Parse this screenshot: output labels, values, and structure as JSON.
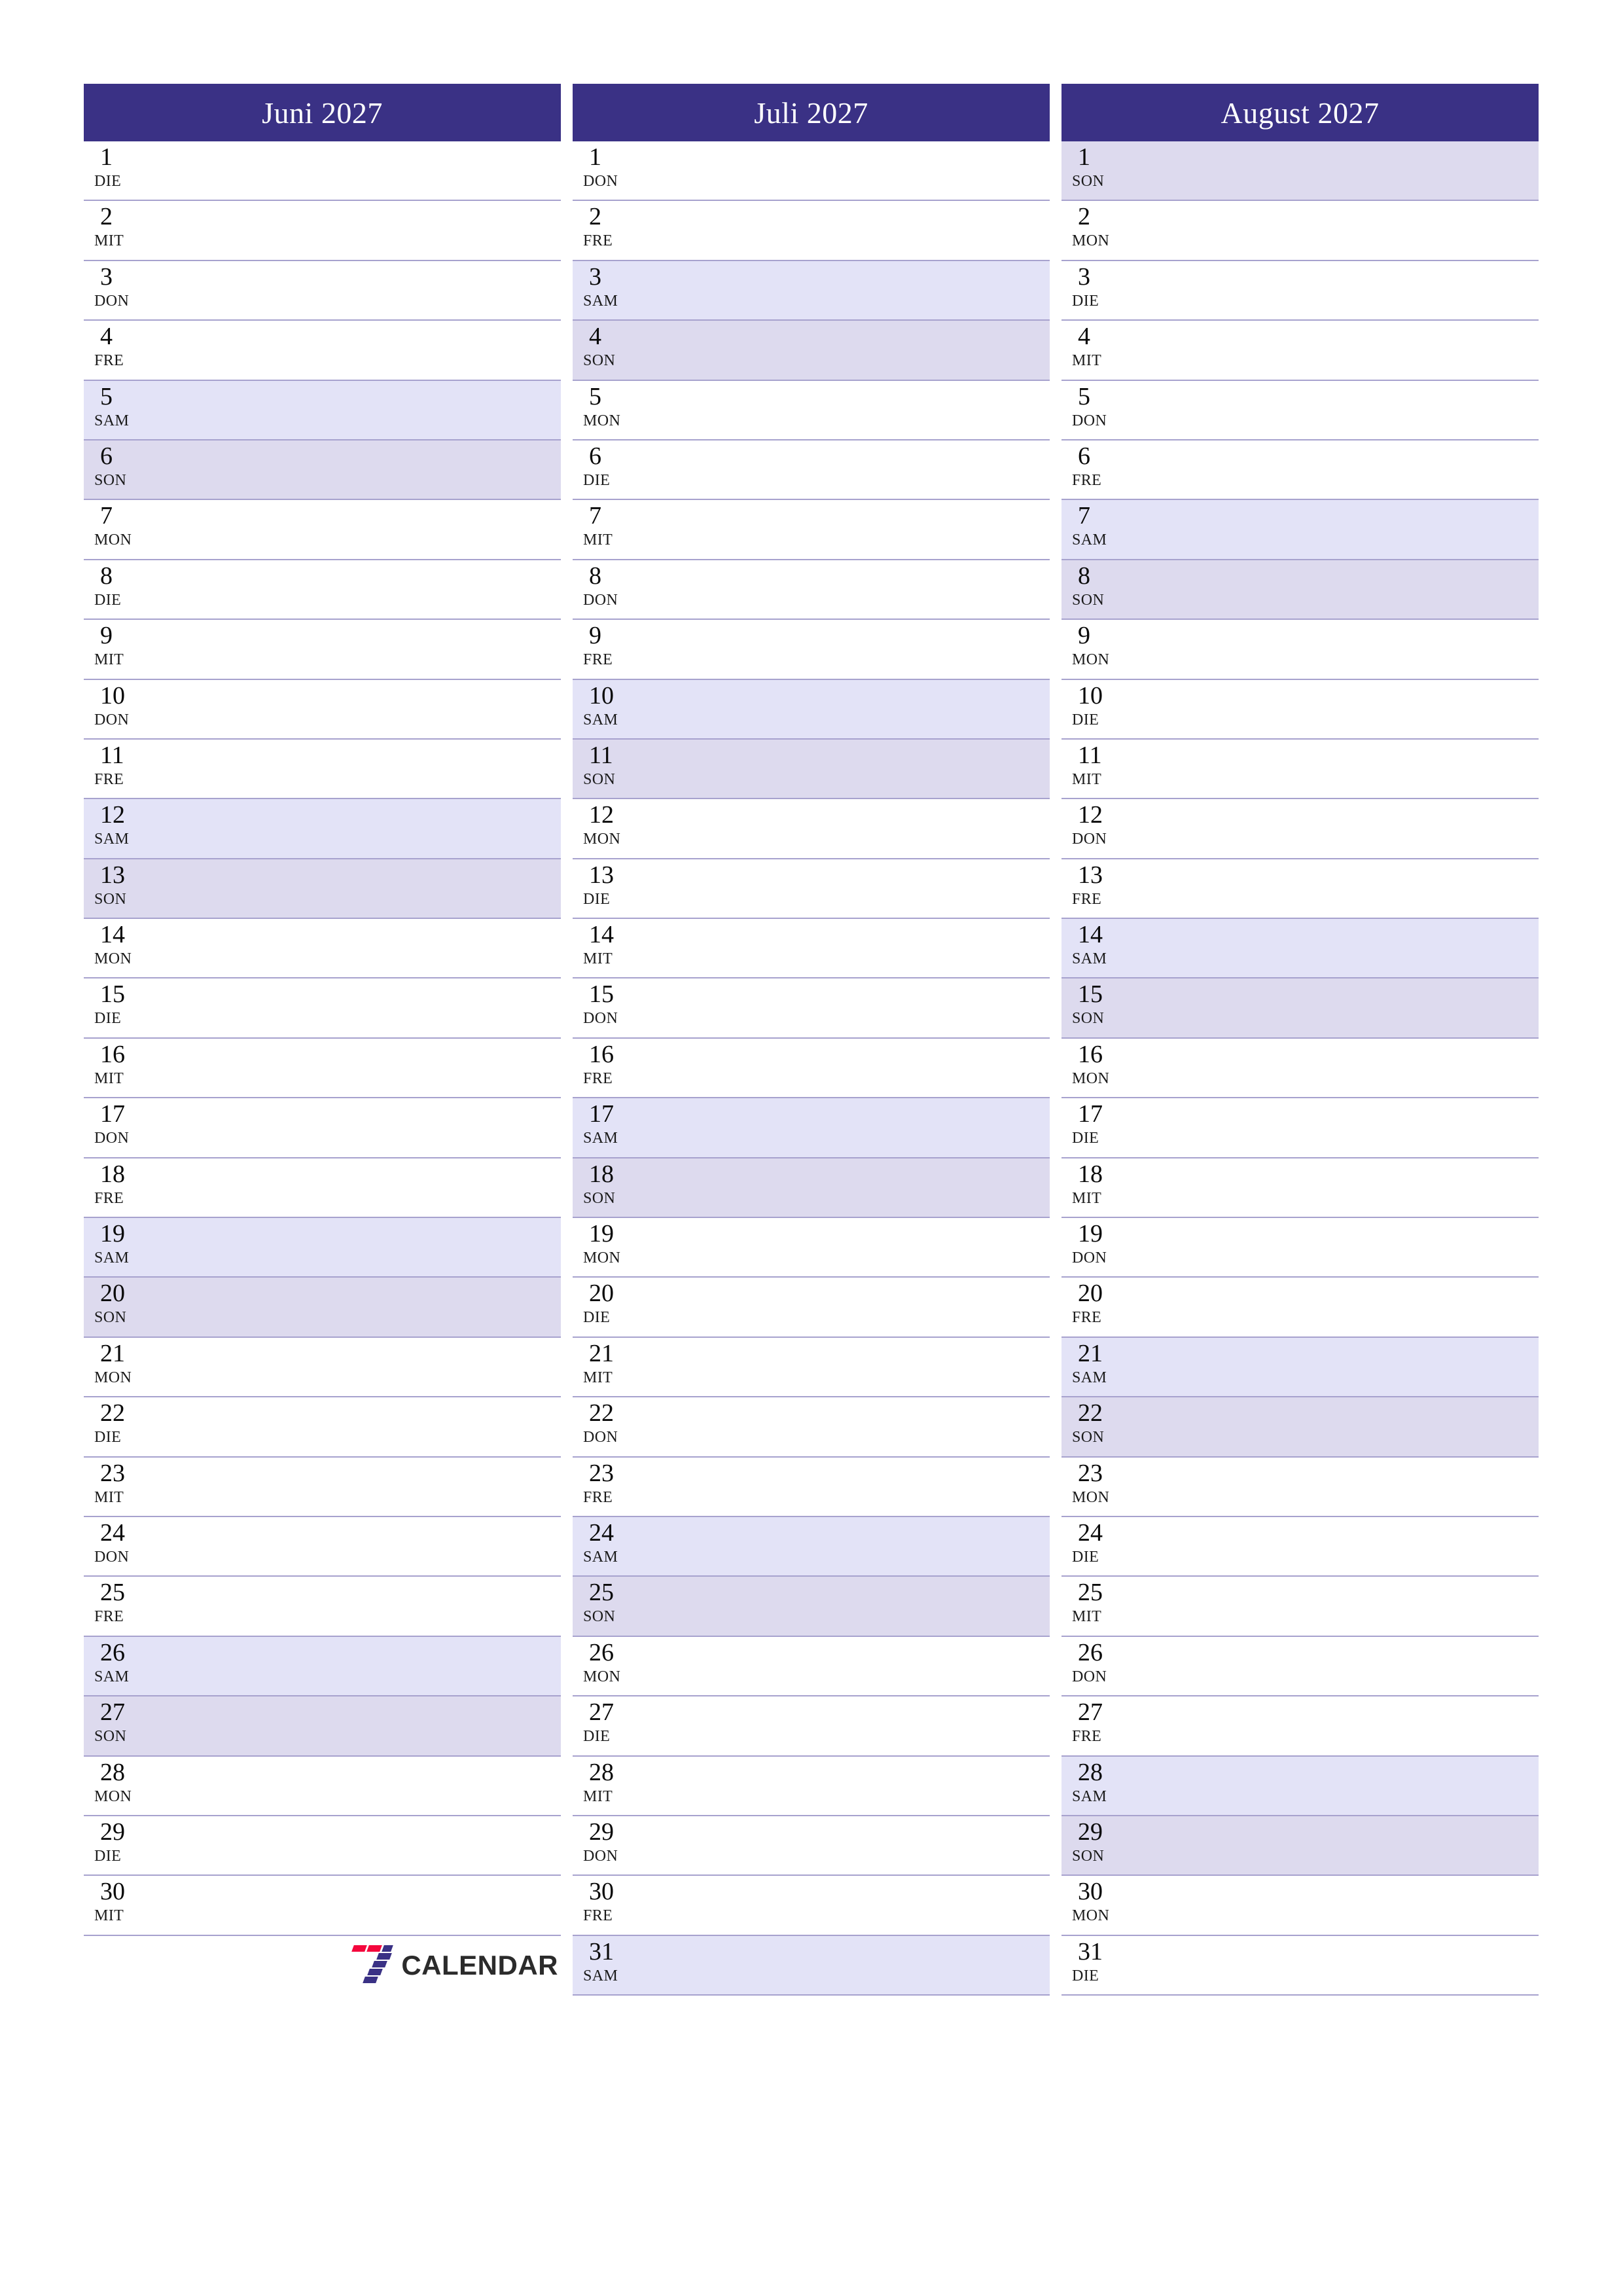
{
  "colors": {
    "header_bg": "#3a3185",
    "header_text": "#ffffff",
    "saturday_bg": "#e3e3f7",
    "sunday_bg": "#dddaee",
    "row_line": "#a7a2ce",
    "logo_red": "#f4063c",
    "logo_blue": "#3a3185",
    "logo_text": "#2b2b2b",
    "page_bg": "#ffffff"
  },
  "logo": {
    "mark": "seven-stripes-icon",
    "text": "CALENDAR"
  },
  "months": [
    {
      "title": "Juni 2027",
      "days": [
        {
          "num": "1",
          "wd": "DIE",
          "type": "weekday"
        },
        {
          "num": "2",
          "wd": "MIT",
          "type": "weekday"
        },
        {
          "num": "3",
          "wd": "DON",
          "type": "weekday"
        },
        {
          "num": "4",
          "wd": "FRE",
          "type": "weekday"
        },
        {
          "num": "5",
          "wd": "SAM",
          "type": "sat"
        },
        {
          "num": "6",
          "wd": "SON",
          "type": "sun"
        },
        {
          "num": "7",
          "wd": "MON",
          "type": "weekday"
        },
        {
          "num": "8",
          "wd": "DIE",
          "type": "weekday"
        },
        {
          "num": "9",
          "wd": "MIT",
          "type": "weekday"
        },
        {
          "num": "10",
          "wd": "DON",
          "type": "weekday"
        },
        {
          "num": "11",
          "wd": "FRE",
          "type": "weekday"
        },
        {
          "num": "12",
          "wd": "SAM",
          "type": "sat"
        },
        {
          "num": "13",
          "wd": "SON",
          "type": "sun"
        },
        {
          "num": "14",
          "wd": "MON",
          "type": "weekday"
        },
        {
          "num": "15",
          "wd": "DIE",
          "type": "weekday"
        },
        {
          "num": "16",
          "wd": "MIT",
          "type": "weekday"
        },
        {
          "num": "17",
          "wd": "DON",
          "type": "weekday"
        },
        {
          "num": "18",
          "wd": "FRE",
          "type": "weekday"
        },
        {
          "num": "19",
          "wd": "SAM",
          "type": "sat"
        },
        {
          "num": "20",
          "wd": "SON",
          "type": "sun"
        },
        {
          "num": "21",
          "wd": "MON",
          "type": "weekday"
        },
        {
          "num": "22",
          "wd": "DIE",
          "type": "weekday"
        },
        {
          "num": "23",
          "wd": "MIT",
          "type": "weekday"
        },
        {
          "num": "24",
          "wd": "DON",
          "type": "weekday"
        },
        {
          "num": "25",
          "wd": "FRE",
          "type": "weekday"
        },
        {
          "num": "26",
          "wd": "SAM",
          "type": "sat"
        },
        {
          "num": "27",
          "wd": "SON",
          "type": "sun"
        },
        {
          "num": "28",
          "wd": "MON",
          "type": "weekday"
        },
        {
          "num": "29",
          "wd": "DIE",
          "type": "weekday"
        },
        {
          "num": "30",
          "wd": "MIT",
          "type": "weekday"
        }
      ],
      "has_logo": true
    },
    {
      "title": "Juli 2027",
      "days": [
        {
          "num": "1",
          "wd": "DON",
          "type": "weekday"
        },
        {
          "num": "2",
          "wd": "FRE",
          "type": "weekday"
        },
        {
          "num": "3",
          "wd": "SAM",
          "type": "sat"
        },
        {
          "num": "4",
          "wd": "SON",
          "type": "sun"
        },
        {
          "num": "5",
          "wd": "MON",
          "type": "weekday"
        },
        {
          "num": "6",
          "wd": "DIE",
          "type": "weekday"
        },
        {
          "num": "7",
          "wd": "MIT",
          "type": "weekday"
        },
        {
          "num": "8",
          "wd": "DON",
          "type": "weekday"
        },
        {
          "num": "9",
          "wd": "FRE",
          "type": "weekday"
        },
        {
          "num": "10",
          "wd": "SAM",
          "type": "sat"
        },
        {
          "num": "11",
          "wd": "SON",
          "type": "sun"
        },
        {
          "num": "12",
          "wd": "MON",
          "type": "weekday"
        },
        {
          "num": "13",
          "wd": "DIE",
          "type": "weekday"
        },
        {
          "num": "14",
          "wd": "MIT",
          "type": "weekday"
        },
        {
          "num": "15",
          "wd": "DON",
          "type": "weekday"
        },
        {
          "num": "16",
          "wd": "FRE",
          "type": "weekday"
        },
        {
          "num": "17",
          "wd": "SAM",
          "type": "sat"
        },
        {
          "num": "18",
          "wd": "SON",
          "type": "sun"
        },
        {
          "num": "19",
          "wd": "MON",
          "type": "weekday"
        },
        {
          "num": "20",
          "wd": "DIE",
          "type": "weekday"
        },
        {
          "num": "21",
          "wd": "MIT",
          "type": "weekday"
        },
        {
          "num": "22",
          "wd": "DON",
          "type": "weekday"
        },
        {
          "num": "23",
          "wd": "FRE",
          "type": "weekday"
        },
        {
          "num": "24",
          "wd": "SAM",
          "type": "sat"
        },
        {
          "num": "25",
          "wd": "SON",
          "type": "sun"
        },
        {
          "num": "26",
          "wd": "MON",
          "type": "weekday"
        },
        {
          "num": "27",
          "wd": "DIE",
          "type": "weekday"
        },
        {
          "num": "28",
          "wd": "MIT",
          "type": "weekday"
        },
        {
          "num": "29",
          "wd": "DON",
          "type": "weekday"
        },
        {
          "num": "30",
          "wd": "FRE",
          "type": "weekday"
        },
        {
          "num": "31",
          "wd": "SAM",
          "type": "sat"
        }
      ],
      "has_logo": false
    },
    {
      "title": "August 2027",
      "days": [
        {
          "num": "1",
          "wd": "SON",
          "type": "sun"
        },
        {
          "num": "2",
          "wd": "MON",
          "type": "weekday"
        },
        {
          "num": "3",
          "wd": "DIE",
          "type": "weekday"
        },
        {
          "num": "4",
          "wd": "MIT",
          "type": "weekday"
        },
        {
          "num": "5",
          "wd": "DON",
          "type": "weekday"
        },
        {
          "num": "6",
          "wd": "FRE",
          "type": "weekday"
        },
        {
          "num": "7",
          "wd": "SAM",
          "type": "sat"
        },
        {
          "num": "8",
          "wd": "SON",
          "type": "sun"
        },
        {
          "num": "9",
          "wd": "MON",
          "type": "weekday"
        },
        {
          "num": "10",
          "wd": "DIE",
          "type": "weekday"
        },
        {
          "num": "11",
          "wd": "MIT",
          "type": "weekday"
        },
        {
          "num": "12",
          "wd": "DON",
          "type": "weekday"
        },
        {
          "num": "13",
          "wd": "FRE",
          "type": "weekday"
        },
        {
          "num": "14",
          "wd": "SAM",
          "type": "sat"
        },
        {
          "num": "15",
          "wd": "SON",
          "type": "sun"
        },
        {
          "num": "16",
          "wd": "MON",
          "type": "weekday"
        },
        {
          "num": "17",
          "wd": "DIE",
          "type": "weekday"
        },
        {
          "num": "18",
          "wd": "MIT",
          "type": "weekday"
        },
        {
          "num": "19",
          "wd": "DON",
          "type": "weekday"
        },
        {
          "num": "20",
          "wd": "FRE",
          "type": "weekday"
        },
        {
          "num": "21",
          "wd": "SAM",
          "type": "sat"
        },
        {
          "num": "22",
          "wd": "SON",
          "type": "sun"
        },
        {
          "num": "23",
          "wd": "MON",
          "type": "weekday"
        },
        {
          "num": "24",
          "wd": "DIE",
          "type": "weekday"
        },
        {
          "num": "25",
          "wd": "MIT",
          "type": "weekday"
        },
        {
          "num": "26",
          "wd": "DON",
          "type": "weekday"
        },
        {
          "num": "27",
          "wd": "FRE",
          "type": "weekday"
        },
        {
          "num": "28",
          "wd": "SAM",
          "type": "sat"
        },
        {
          "num": "29",
          "wd": "SON",
          "type": "sun"
        },
        {
          "num": "30",
          "wd": "MON",
          "type": "weekday"
        },
        {
          "num": "31",
          "wd": "DIE",
          "type": "weekday"
        }
      ],
      "has_logo": false
    }
  ]
}
